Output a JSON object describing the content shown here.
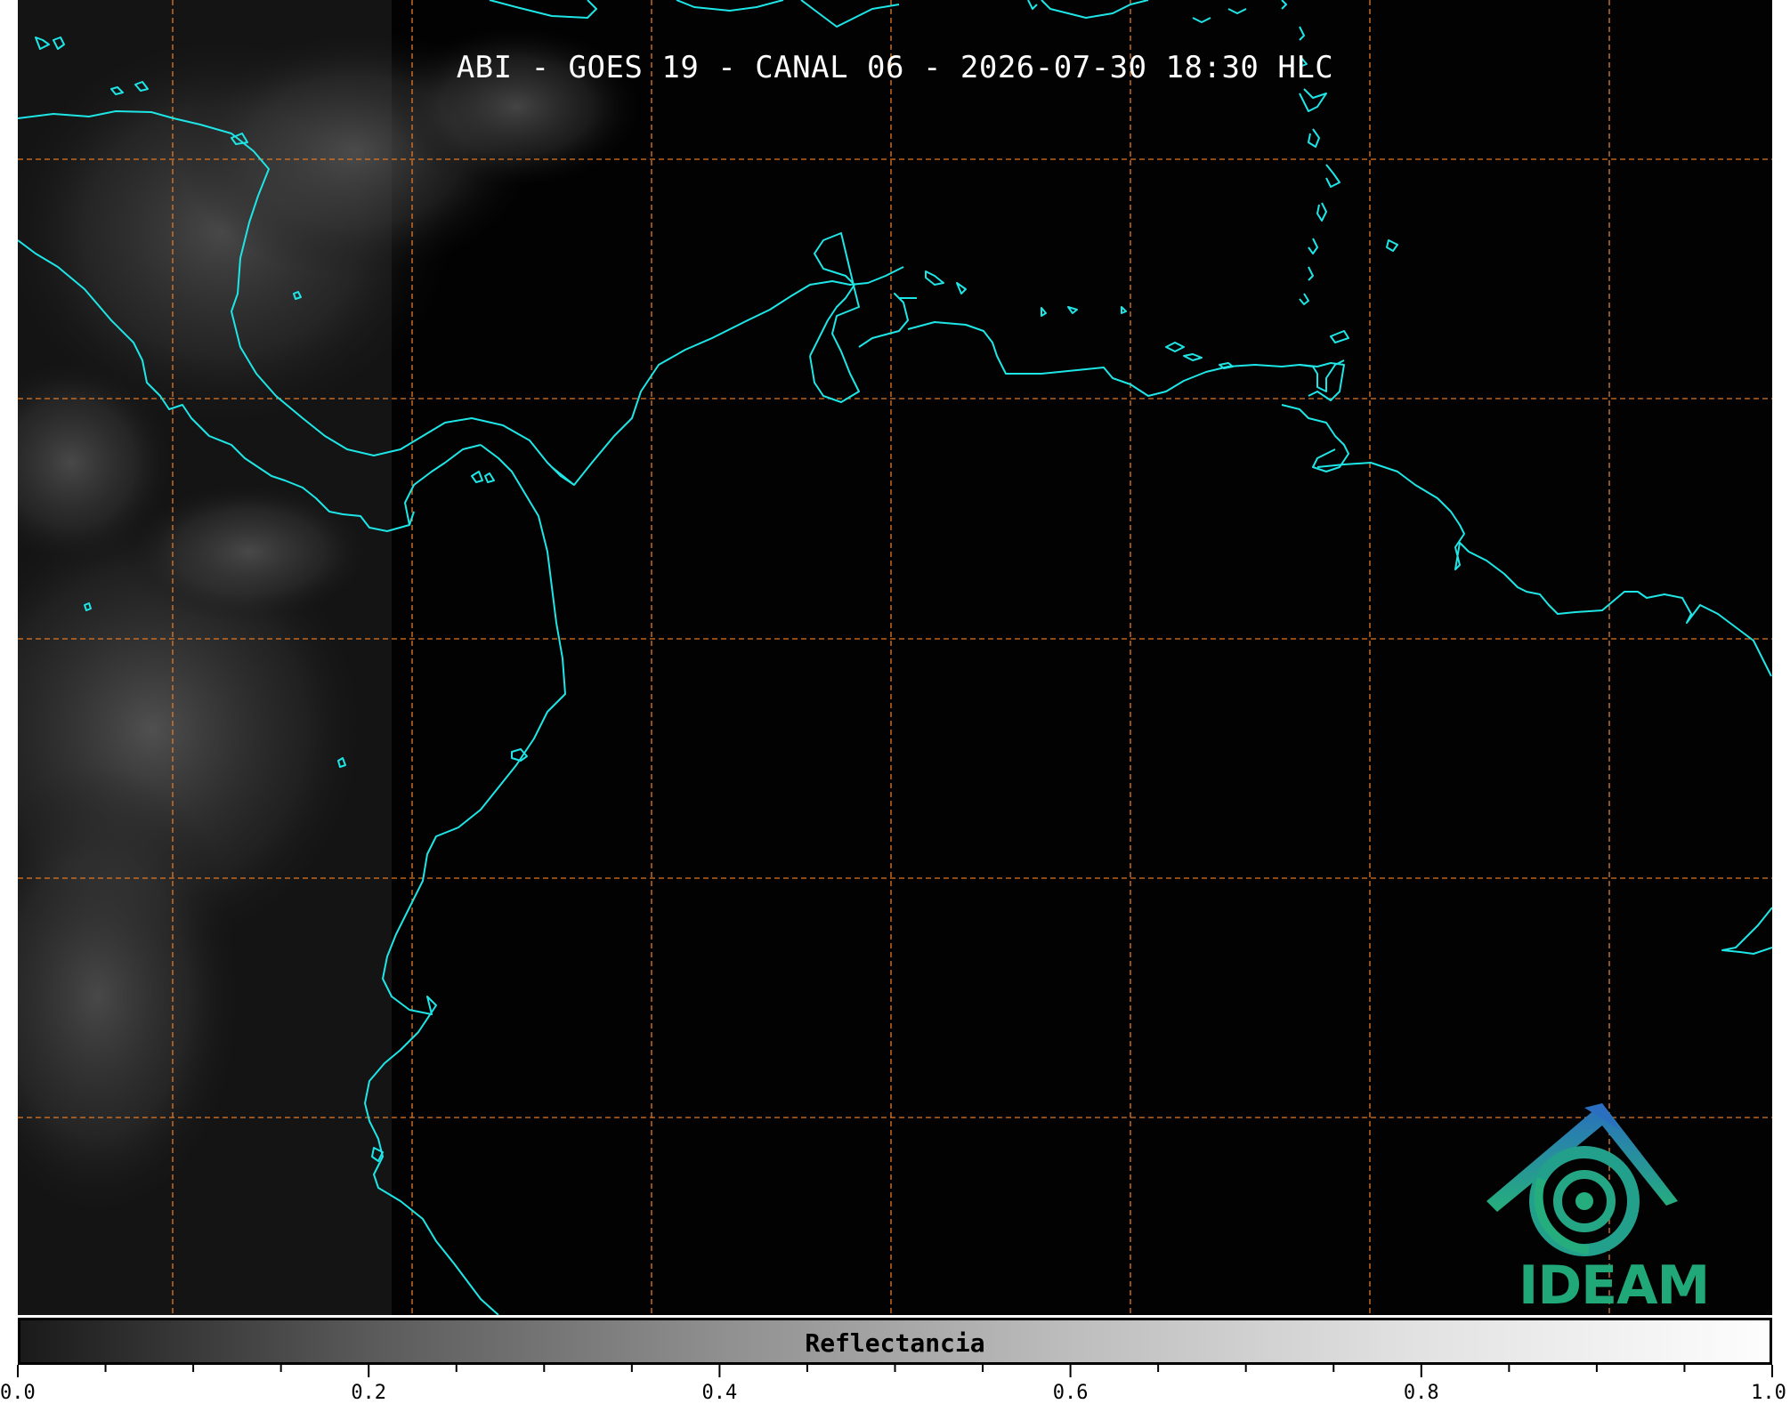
{
  "title": "ABI - GOES 19 - CANAL 06 - 2026-07-30 18:30 HLC",
  "logo": {
    "text": "IDEAM",
    "color": "#20a878"
  },
  "colors": {
    "coastline": "#1fe6e6",
    "gridlines": "#e07a2a",
    "background": "#020202"
  },
  "colorbar": {
    "label": "Reflectancia",
    "range": [
      0.0,
      1.0
    ],
    "ticks": [
      "0.0",
      "0.2",
      "0.4",
      "0.6",
      "0.8",
      "1.0"
    ],
    "colormap": "grayscale"
  }
}
